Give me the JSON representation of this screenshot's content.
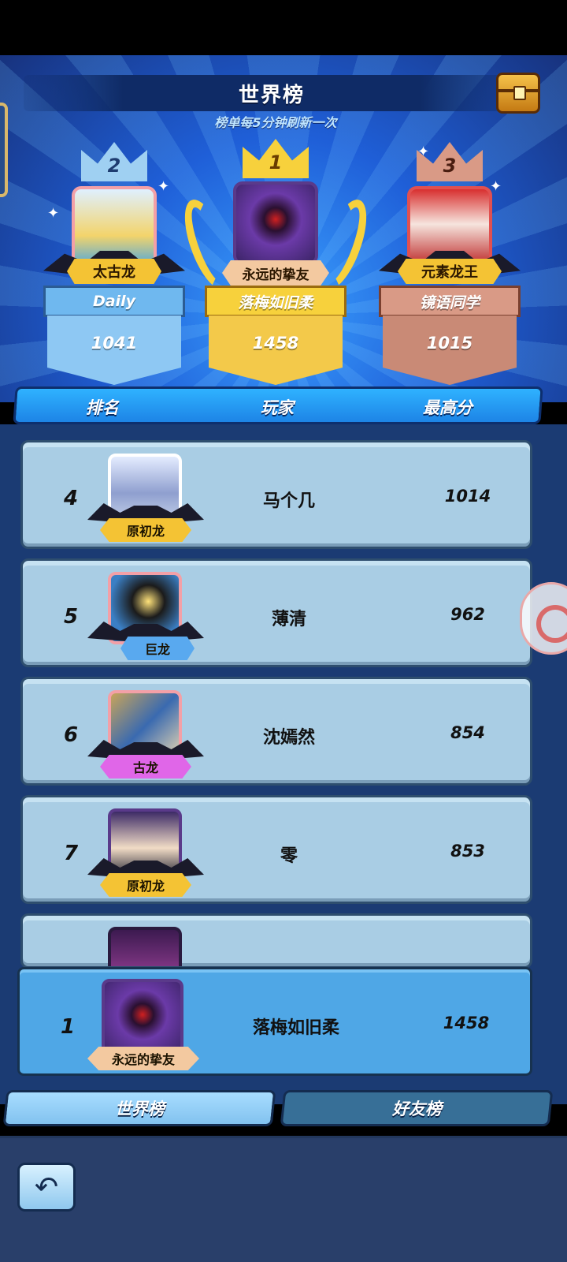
{
  "header": {
    "title": "世界榜",
    "subtitle": "榜单每5分钟刷新一次",
    "chest_icon": "treasure-chest-icon"
  },
  "podium": [
    {
      "rank": "2",
      "dragon": "太古龙",
      "player": "Daily",
      "score": "1041"
    },
    {
      "rank": "1",
      "dragon": "永远的挚友",
      "player": "落梅如旧柔",
      "score": "1458"
    },
    {
      "rank": "3",
      "dragon": "元素龙王",
      "player": "镜语同学",
      "score": "1015"
    }
  ],
  "columns": {
    "rank": "排名",
    "player": "玩家",
    "score": "最高分"
  },
  "rows": [
    {
      "rank": "4",
      "dragon": "原初龙",
      "player": "马个几",
      "score": "1014"
    },
    {
      "rank": "5",
      "dragon": "巨龙",
      "player": "薄清",
      "score": "962"
    },
    {
      "rank": "6",
      "dragon": "古龙",
      "player": "沈嫣然",
      "score": "854"
    },
    {
      "rank": "7",
      "dragon": "原初龙",
      "player": "零",
      "score": "853"
    }
  ],
  "self_row": {
    "rank": "1",
    "dragon": "永远的挚友",
    "player": "落梅如旧柔",
    "score": "1458"
  },
  "tabs": {
    "world": "世界榜",
    "friends": "好友榜"
  },
  "colors": {
    "gold": "#f5c94a",
    "blue": "#6fb8ef",
    "bronze": "#d99a86",
    "pink_tag": "#e066e8"
  },
  "back_icon": "back-arrow-icon",
  "side_icon": "record-icon"
}
